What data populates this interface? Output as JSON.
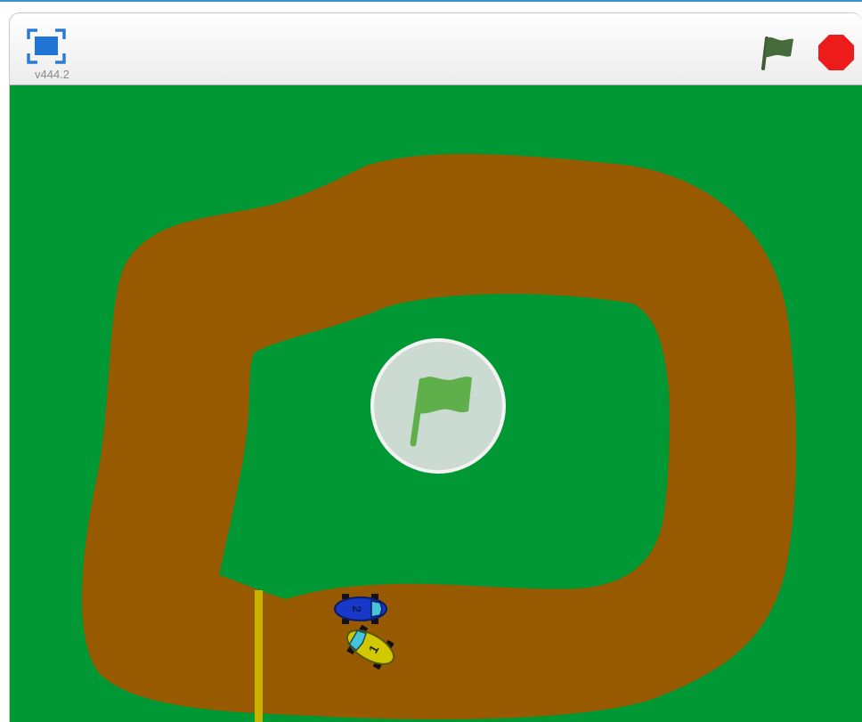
{
  "header": {
    "version_label": "v444.2",
    "fullscreen_icon": "fullscreen-icon",
    "green_flag_icon": "green-flag-icon",
    "stop_icon": "stop-sign-icon"
  },
  "stage": {
    "background_color": "#009834",
    "track_color": "#975a00",
    "finish_line_color": "#c8b400",
    "overlay_icon": "green-flag-icon",
    "cars": [
      {
        "number": "2",
        "color": "#1838c8"
      },
      {
        "number": "1",
        "color": "#d2c800"
      }
    ]
  },
  "colors": {
    "accent_blue": "#1f75d6",
    "flag_green": "#456b3a",
    "stop_red": "#ee1b1b",
    "overlay_flag": "#5fb04b"
  }
}
